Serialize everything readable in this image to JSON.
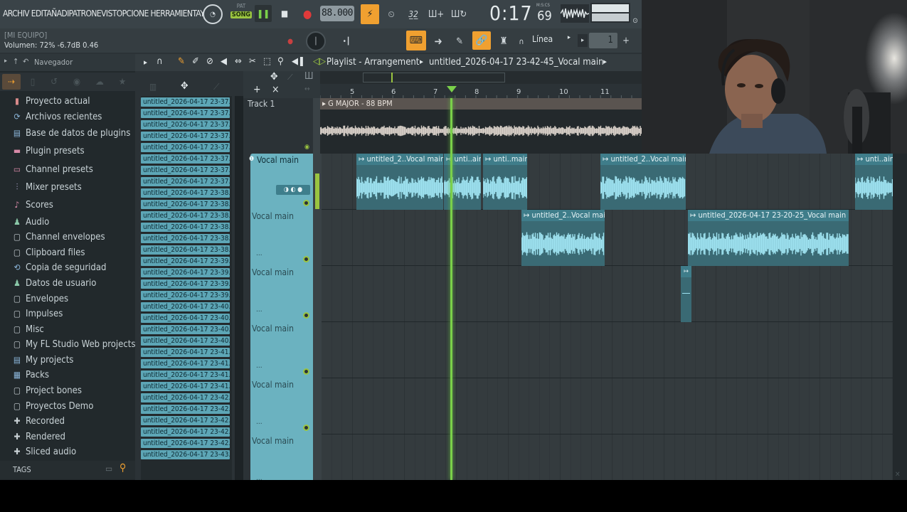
{
  "menu": {
    "text": "ARCHIV EDITAÑADIPATRONEVISTOPCIONE HERRAMIENTAY"
  },
  "transport": {
    "pat_label": "PAT",
    "song_label": "SONG",
    "tempo": "88.000",
    "time": "0:17",
    "time_sub": "69",
    "time_unit": "M:S:CS"
  },
  "hint": {
    "line1": "[MI EQUIPO]",
    "line2": "Volumen: 72%  -6.7dB  0.46"
  },
  "toolbar2": {
    "snap": "Línea",
    "pattern": "1",
    "plus": "+"
  },
  "sidebar": {
    "title": "Navegador",
    "items": [
      {
        "label": "Proyecto actual",
        "icon": "project-icon",
        "color": "#d88a8a"
      },
      {
        "label": "Archivos recientes",
        "icon": "recent-icon",
        "color": "#8ab4d8"
      },
      {
        "label": "Base de datos de plugins",
        "icon": "plugin-db-icon",
        "color": "#8ab4d8"
      },
      {
        "label": "Plugin presets",
        "icon": "plugin-presets-icon",
        "color": "#d88aa8"
      },
      {
        "label": "Channel presets",
        "icon": "channel-presets-icon",
        "color": "#d88aa8"
      },
      {
        "label": "Mixer presets",
        "icon": "mixer-presets-icon",
        "color": "#a8a0c8"
      },
      {
        "label": "Scores",
        "icon": "scores-icon",
        "color": "#d88aa8"
      },
      {
        "label": "Audio",
        "icon": "audio-icon",
        "color": "#8ac8a8"
      },
      {
        "label": "Channel envelopes",
        "icon": "folder-icon",
        "color": "#c8d0d4"
      },
      {
        "label": "Clipboard files",
        "icon": "folder-icon",
        "color": "#c8d0d4"
      },
      {
        "label": "Copia de seguridad",
        "icon": "backup-icon",
        "color": "#8ab4d8"
      },
      {
        "label": "Datos de usuario",
        "icon": "user-data-icon",
        "color": "#8ac8a8"
      },
      {
        "label": "Envelopes",
        "icon": "folder-icon",
        "color": "#c8d0d4"
      },
      {
        "label": "Impulses",
        "icon": "folder-icon",
        "color": "#c8d0d4"
      },
      {
        "label": "Misc",
        "icon": "folder-icon",
        "color": "#c8d0d4"
      },
      {
        "label": "My FL Studio Web projects",
        "icon": "folder-icon",
        "color": "#c8d0d4"
      },
      {
        "label": "My projects",
        "icon": "my-projects-icon",
        "color": "#8ab4d8"
      },
      {
        "label": "Packs",
        "icon": "packs-icon",
        "color": "#8ab4d8"
      },
      {
        "label": "Project bones",
        "icon": "folder-icon",
        "color": "#c8d0d4"
      },
      {
        "label": "Proyectos Demo",
        "icon": "folder-icon",
        "color": "#c8d0d4"
      },
      {
        "label": "Recorded",
        "icon": "recorded-icon",
        "color": "#c8d0d4"
      },
      {
        "label": "Rendered",
        "icon": "rendered-icon",
        "color": "#c8d0d4"
      },
      {
        "label": "Sliced audio",
        "icon": "sliced-audio-icon",
        "color": "#c8d0d4"
      }
    ],
    "tags": "TAGS"
  },
  "clips": [
    "untitled_2026-04-17 23-37...",
    "untitled_2026-04-17 23-37...",
    "untitled_2026-04-17 23-37...",
    "untitled_2026-04-17 23-37...",
    "untitled_2026-04-17 23-37...",
    "untitled_2026-04-17 23-37...",
    "untitled_2026-04-17 23-37...",
    "untitled_2026-04-17 23-37...",
    "untitled_2026-04-17 23-38...",
    "untitled_2026-04-17 23-38...",
    "untitled_2026-04-17 23-38...",
    "untitled_2026-04-17 23-38...",
    "untitled_2026-04-17 23-38...",
    "untitled_2026-04-17 23-38...",
    "untitled_2026-04-17 23-39...",
    "untitled_2026-04-17 23-39...",
    "untitled_2026-04-17 23-39...",
    "untitled_2026-04-17 23-39...",
    "untitled_2026-04-17 23-40...",
    "untitled_2026-04-17 23-40...",
    "untitled_2026-04-17 23-40...",
    "untitled_2026-04-17 23-40...",
    "untitled_2026-04-17 23-41...",
    "untitled_2026-04-17 23-41...",
    "untitled_2026-04-17 23-41...",
    "untitled_2026-04-17 23-41...",
    "untitled_2026-04-17 23-42...",
    "untitled_2026-04-17 23-42...",
    "untitled_2026-04-17 23-42...",
    "untitled_2026-04-17 23-42...",
    "untitled_2026-04-17 23-42...",
    "untitled_2026-04-17 23-43..."
  ],
  "playlist": {
    "title": "Playlist - Arrangement",
    "breadcrumb": "untitled_2026-04-17 23-42-45_Vocal main",
    "ruler": [
      "5",
      "6",
      "7",
      "8",
      "9",
      "10",
      "11"
    ]
  },
  "track1": {
    "name": "Track 1",
    "marker": "G MAJOR - 88 BPM"
  },
  "tracks": [
    {
      "name": "Vocal main"
    },
    {
      "name": "Vocal main"
    },
    {
      "name": "Vocal main"
    },
    {
      "name": "Vocal main"
    },
    {
      "name": "Vocal main"
    },
    {
      "name": "Vocal main"
    }
  ],
  "audio_clips": [
    {
      "label": "untitled_2..Vocal main"
    },
    {
      "label": "unti..ain"
    },
    {
      "label": "unti..main"
    },
    {
      "label": "untitled_2..Vocal main"
    },
    {
      "label": "unti..ain"
    },
    {
      "label": "untitled_2..Vocal main"
    },
    {
      "label": "untitled_2026-04-17 23-20-25_Vocal main"
    }
  ],
  "colors": {
    "accent": "#f0a030",
    "clip": "#5da6b6",
    "playhead": "#7ad04a",
    "track_header": "#6bb2c0"
  }
}
